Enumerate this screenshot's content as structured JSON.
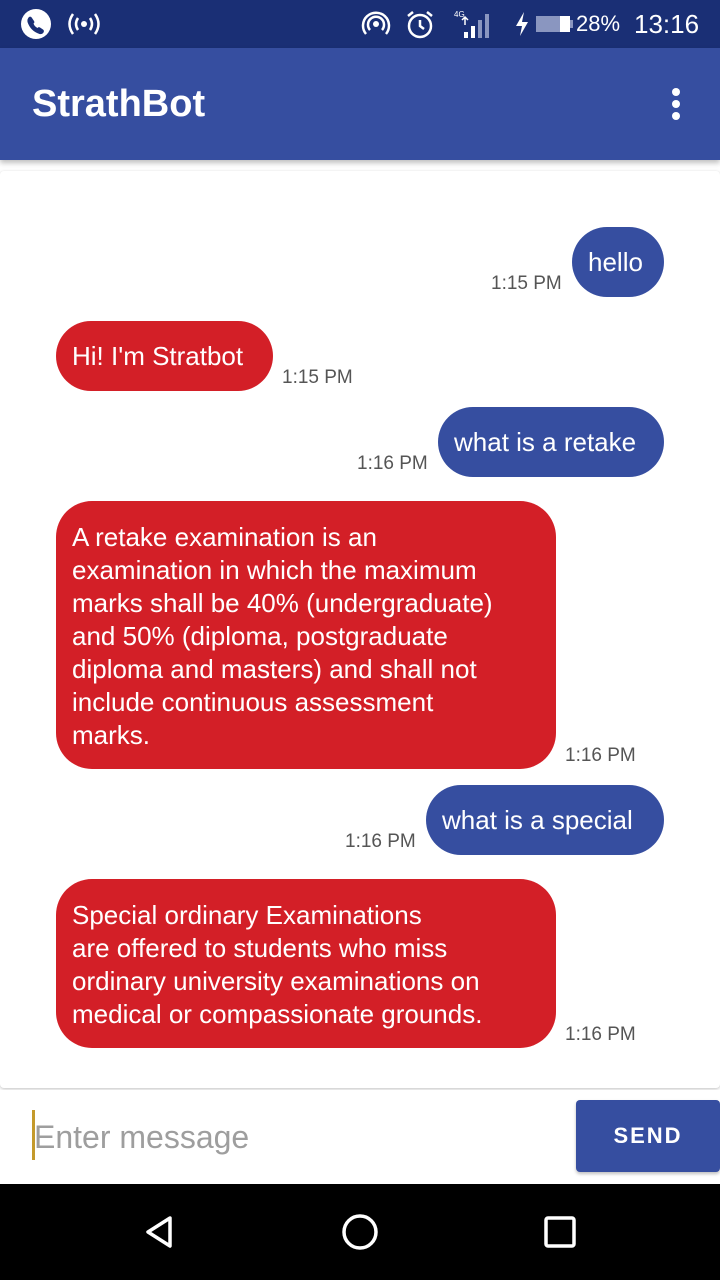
{
  "status_bar": {
    "battery_percent": "28%",
    "time": "13:16",
    "network": "4G",
    "icons": [
      "phone-call-icon",
      "wireless-signal-icon",
      "hotspot-icon",
      "alarm-icon",
      "cell-signal-icon",
      "charging-icon",
      "battery-icon"
    ]
  },
  "app_bar": {
    "title": "StrathBot",
    "menu_icon": "overflow-menu-icon"
  },
  "messages": [
    {
      "from": "user",
      "text": "hello",
      "time": "1:15 PM"
    },
    {
      "from": "bot",
      "text": "Hi! I'm Stratbot",
      "time": "1:15 PM"
    },
    {
      "from": "user",
      "text": "what is a retake",
      "time": "1:16 PM"
    },
    {
      "from": "bot",
      "lines": [
        "A retake examination is an",
        "examination in which the maximum",
        "marks shall be 40% (undergraduate)",
        "and 50% (diploma, postgraduate",
        "diploma and masters) and shall not",
        "include continuous assessment",
        "marks."
      ],
      "time": "1:16 PM"
    },
    {
      "from": "user",
      "text": "what is a special",
      "time": "1:16 PM"
    },
    {
      "from": "bot",
      "lines": [
        "Special ordinary Examinations",
        "are offered to students who miss",
        "ordinary university examinations on",
        "medical or compassionate grounds."
      ],
      "time": "1:16 PM"
    }
  ],
  "composer": {
    "placeholder": "Enter message",
    "value": "",
    "send_label": "SEND"
  },
  "colors": {
    "status_bar": "#1a2f75",
    "primary": "#364ea0",
    "bot_bubble": "#d31f27",
    "timestamp": "#555555"
  },
  "nav_bar": {
    "icons": [
      "back-icon",
      "home-icon",
      "recents-icon"
    ]
  }
}
